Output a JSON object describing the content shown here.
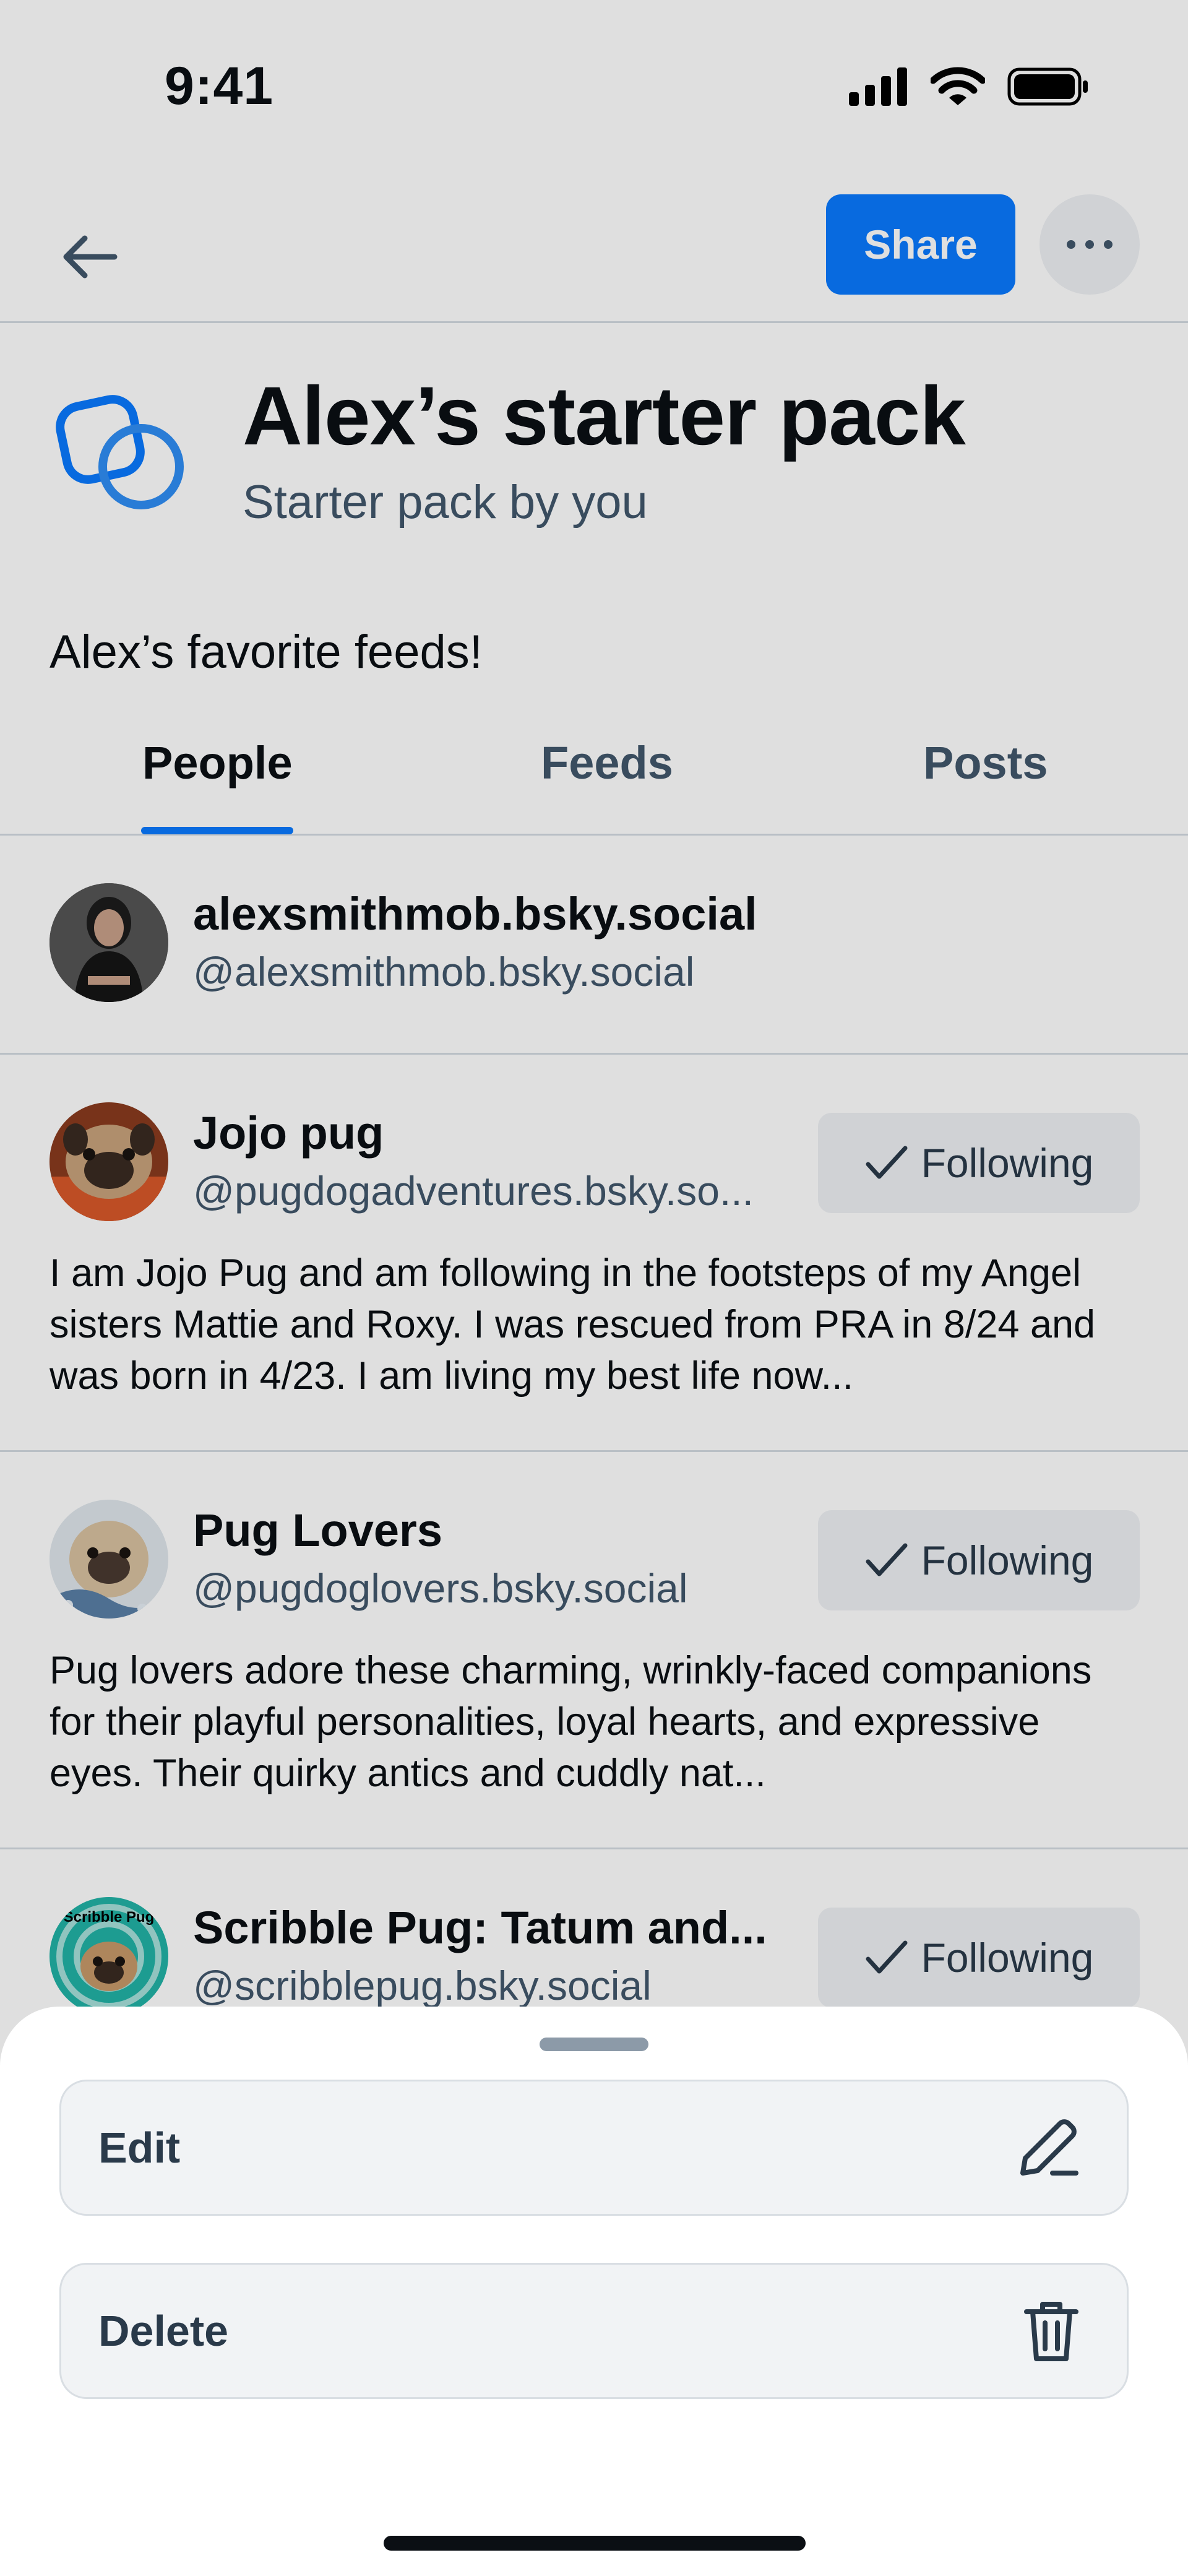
{
  "status_bar": {
    "time": "9:41"
  },
  "header": {
    "share_label": "Share"
  },
  "pack": {
    "title": "Alex’s starter pack",
    "subtitle": "Starter pack by you",
    "description": "Alex’s favorite feeds!"
  },
  "tabs": [
    {
      "label": "People",
      "active": true
    },
    {
      "label": "Feeds",
      "active": false
    },
    {
      "label": "Posts",
      "active": false
    }
  ],
  "people": [
    {
      "display_name": "alexsmithmob.bsky.social",
      "handle": "@alexsmithmob.bsky.social",
      "bio": "",
      "following": false,
      "follow_label": ""
    },
    {
      "display_name": "Jojo pug",
      "handle": "@pugdogadventures.bsky.so...",
      "bio": "I am Jojo Pug and am following in the footsteps of my Angel sisters Mattie and Roxy.  I was rescued from PRA in 8/24 and was born in 4/23.  I am living my best life now...",
      "following": true,
      "follow_label": "Following"
    },
    {
      "display_name": "Pug Lovers",
      "handle": "@pugdoglovers.bsky.social",
      "bio": "Pug lovers adore these charming, wrinkly-faced companions for their playful personalities, loyal hearts, and expressive eyes. Their quirky antics and cuddly nat...",
      "following": true,
      "follow_label": "Following"
    },
    {
      "display_name": "Scribble Pug: Tatum and...",
      "handle": "@scribblepug.bsky.social",
      "bio": "",
      "following": true,
      "follow_label": "Following"
    }
  ],
  "avatar_art": {
    "scribble_text": "Scribble Pug"
  },
  "sheet": {
    "items": [
      {
        "label": "Edit",
        "icon": "pencil-icon"
      },
      {
        "label": "Delete",
        "icon": "trash-icon"
      }
    ]
  },
  "colors": {
    "accent": "#0a7aff",
    "text_secondary": "#42576c",
    "divider": "#d4dbe2"
  }
}
